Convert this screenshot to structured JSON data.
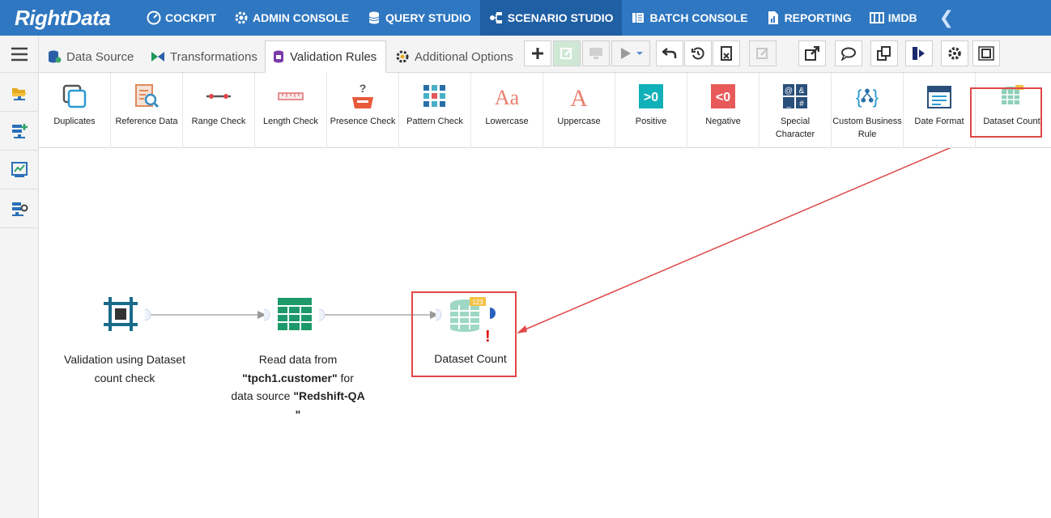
{
  "brand": {
    "logo_text": "RightData"
  },
  "nav": {
    "items": [
      {
        "label": "COCKPIT"
      },
      {
        "label": "ADMIN CONSOLE"
      },
      {
        "label": "QUERY STUDIO"
      },
      {
        "label": "SCENARIO STUDIO"
      },
      {
        "label": "BATCH CONSOLE"
      },
      {
        "label": "REPORTING"
      },
      {
        "label": "IMDB"
      }
    ],
    "active": "SCENARIO STUDIO"
  },
  "tabs": [
    {
      "label": "Data Source"
    },
    {
      "label": "Transformations"
    },
    {
      "label": "Validation Rules"
    },
    {
      "label": "Additional Options"
    }
  ],
  "active_tab": "Validation Rules",
  "ribbon": {
    "rules": [
      {
        "label": "Duplicates"
      },
      {
        "label": "Reference Data"
      },
      {
        "label": "Range Check"
      },
      {
        "label": "Length Check"
      },
      {
        "label": "Presence Check"
      },
      {
        "label": "Pattern Check"
      },
      {
        "label": "Lowercase"
      },
      {
        "label": "Uppercase"
      },
      {
        "label": "Positive"
      },
      {
        "label": "Negative"
      },
      {
        "label": "Special Character"
      },
      {
        "label": "Custom Business Rule"
      },
      {
        "label": "Date Format"
      },
      {
        "label": "Dataset Count"
      }
    ],
    "icon_text": {
      "positive": ">0",
      "negative": "<0",
      "lowercase": "Aa",
      "uppercase": "A",
      "presence": "?"
    }
  },
  "canvas": {
    "nodes": {
      "start": {
        "label": "Validation using Dataset count check"
      },
      "read": {
        "prefix": "Read data from",
        "table": "\"tpch1.customer\"",
        "middle": "for data source",
        "source": "\"Redshift-QA \""
      },
      "dataset": {
        "label": "Dataset Count",
        "badge": "123",
        "warning": "!"
      }
    }
  },
  "colors": {
    "nav_bg": "#2f77c0",
    "nav_active": "#1f5fa3",
    "highlight": "#e04848",
    "green": "#1e9a6a",
    "teal": "#1a6b8a"
  }
}
